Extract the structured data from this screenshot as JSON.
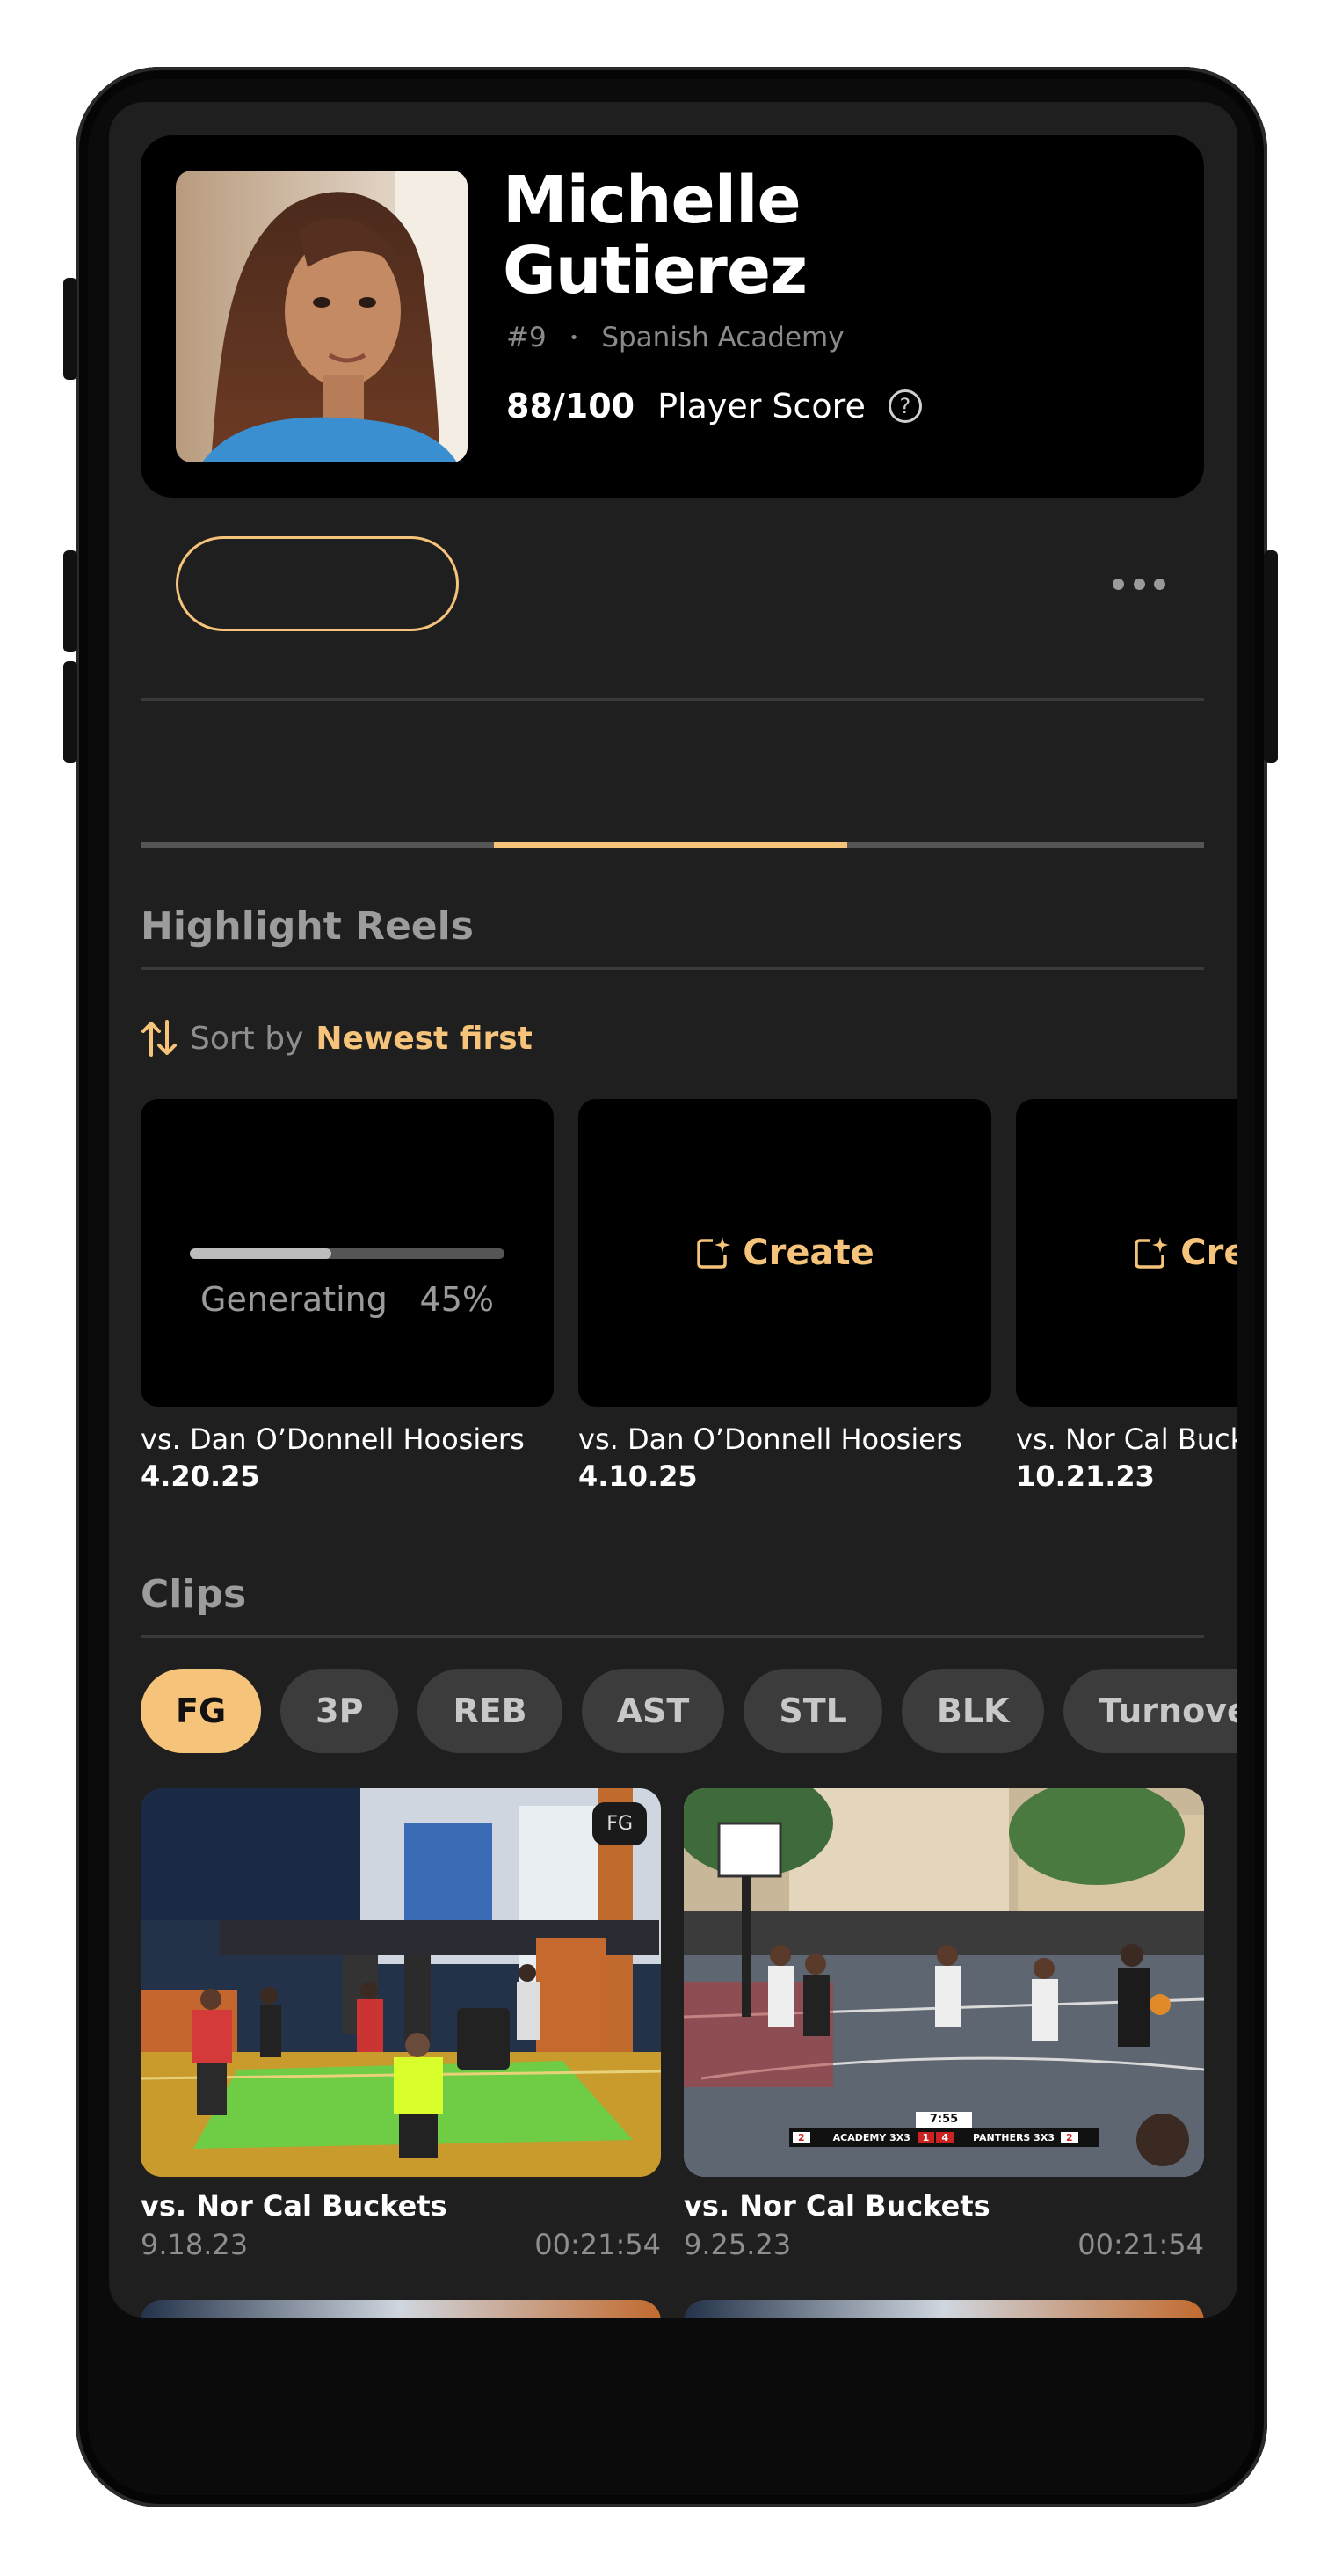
{
  "profile": {
    "name_line1": "Michelle",
    "name_line2": "Gutierez",
    "number": "#9",
    "separator": "•",
    "team": "Spanish Academy",
    "score": "88/100",
    "score_label": "Player Score",
    "help_icon_glyph": "?"
  },
  "actions": {
    "follow_label": "",
    "more_icon": "more-horizontal-icon"
  },
  "tabs": {
    "active_index": 1,
    "count": 3
  },
  "highlight_reels": {
    "title": "Highlight Reels",
    "sort_prefix": "Sort by",
    "sort_value": "Newest first",
    "reels": [
      {
        "state": "generating",
        "label": "Generating",
        "progress_text": "45%",
        "progress": 0.45,
        "title": "vs. Dan O’Donnell Hoosiers",
        "date": "4.20.25"
      },
      {
        "state": "create",
        "label": "Create",
        "title": "vs. Dan O’Donnell Hoosiers",
        "date": "4.10.25"
      },
      {
        "state": "create",
        "label": "Create",
        "title": "vs. Nor Cal Buckets",
        "date": "10.21.23"
      }
    ]
  },
  "clips": {
    "title": "Clips",
    "filters": [
      "FG",
      "3P",
      "REB",
      "AST",
      "STL",
      "BLK",
      "Turnovers"
    ],
    "active_filter": "FG",
    "items": [
      {
        "title": "vs. Nor Cal Buckets",
        "date": "9.18.23",
        "duration": "00:21:54",
        "badge": "FG"
      },
      {
        "title": "vs. Nor Cal Buckets",
        "date": "9.25.23",
        "duration": "00:21:54",
        "scoreboard": {
          "time": "7:55",
          "home": "ACADEMY 3X3",
          "home_pts": "2",
          "away": "PANTHERS 3X3",
          "away_pts": "2",
          "mid_left": "1",
          "mid_right": "4"
        }
      }
    ]
  },
  "colors": {
    "accent": "#f6c37a",
    "background": "#1f1f1f",
    "card": "#000000"
  }
}
